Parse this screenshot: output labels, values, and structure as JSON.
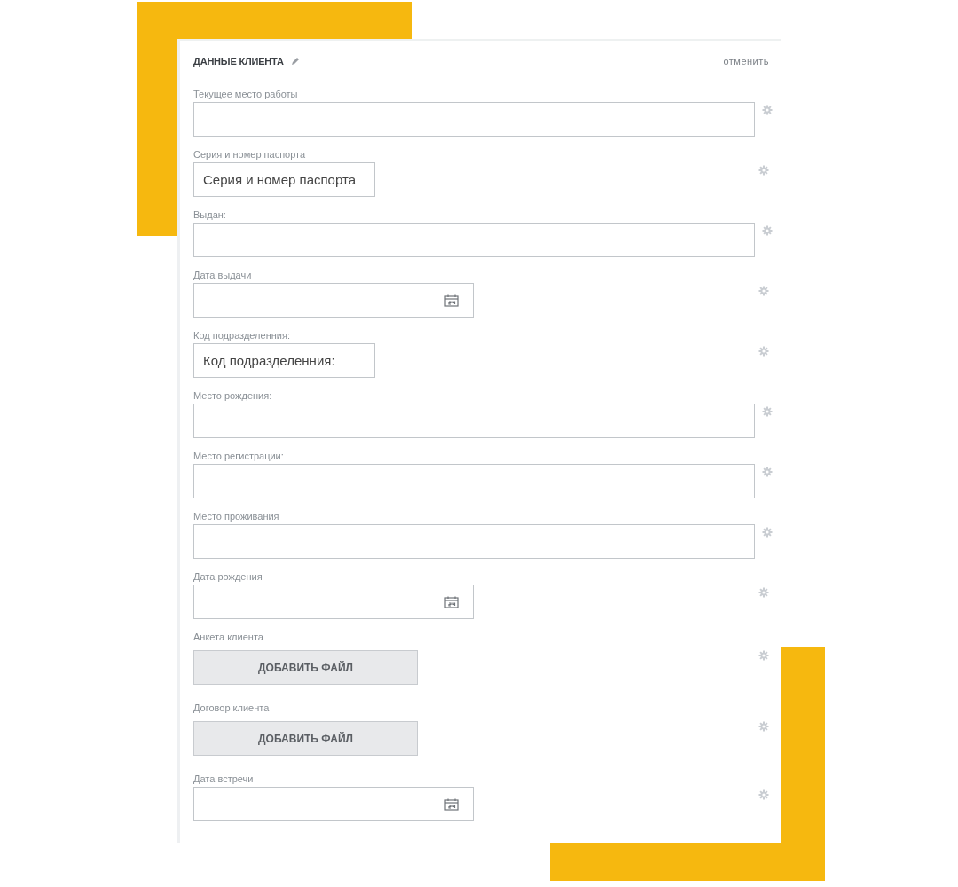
{
  "header": {
    "title": "ДАННЫЕ КЛИЕНТА",
    "cancel": "отменить"
  },
  "fields": [
    {
      "kind": "text",
      "label": "Текущее место работы"
    },
    {
      "kind": "short",
      "label": "Серия и номер паспорта",
      "placeholder": "Серия и номер паспорта"
    },
    {
      "kind": "text",
      "label": "Выдан:"
    },
    {
      "kind": "date",
      "label": "Дата выдачи"
    },
    {
      "kind": "short",
      "label": "Код подразделенния:",
      "placeholder": "Код подразделенния:"
    },
    {
      "kind": "text",
      "label": "Место рождения:"
    },
    {
      "kind": "text",
      "label": "Место регистрации:"
    },
    {
      "kind": "text",
      "label": "Место проживания"
    },
    {
      "kind": "date",
      "label": "Дата рождения"
    },
    {
      "kind": "file",
      "label": "Анкета клиента",
      "button": "ДОБАВИТЬ ФАЙЛ"
    },
    {
      "kind": "file",
      "label": "Договор клиента",
      "button": "ДОБАВИТЬ ФАЙЛ"
    },
    {
      "kind": "date",
      "label": "Дата встречи"
    }
  ]
}
